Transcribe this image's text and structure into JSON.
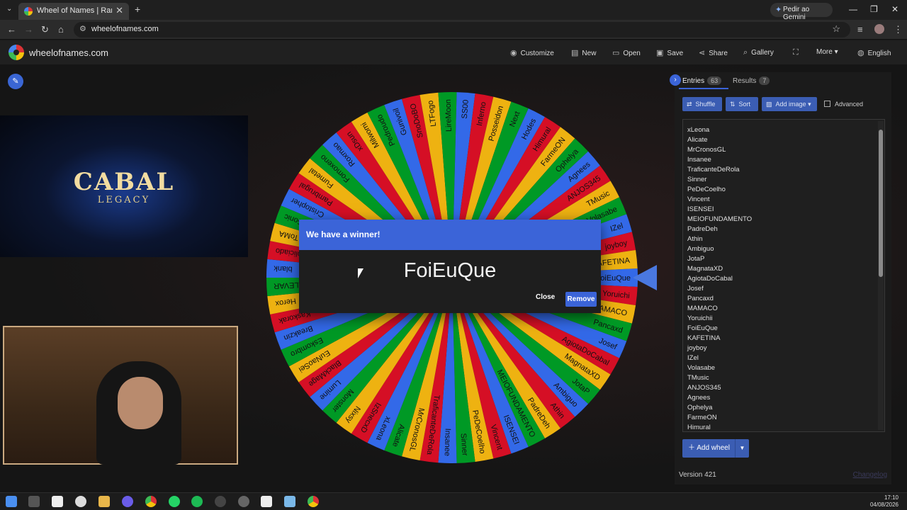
{
  "browser": {
    "tab_title": "Wheel of Names | Random nam",
    "gemini_label": "Pedir ao Gemini",
    "url": "wheelofnames.com",
    "tab_close": "✕",
    "new_tab": "+",
    "win_min": "—",
    "win_max": "❐",
    "win_close": "✕"
  },
  "app": {
    "brand": "wheelofnames.com",
    "menu": [
      {
        "label": "Customize",
        "icon": "palette-icon"
      },
      {
        "label": "New",
        "icon": "file-icon"
      },
      {
        "label": "Open",
        "icon": "folder-icon"
      },
      {
        "label": "Save",
        "icon": "save-icon"
      },
      {
        "label": "Share",
        "icon": "share-icon"
      },
      {
        "label": "Gallery",
        "icon": "search-icon"
      },
      {
        "label": "More",
        "icon": "chevron-down-icon"
      },
      {
        "label": "English",
        "icon": "globe-icon"
      }
    ]
  },
  "stream": {
    "banner_title": "CABAL",
    "banner_subtitle": "LEGACY"
  },
  "wheel": {
    "colors": [
      "#3369e8",
      "#d50f25",
      "#eeb211",
      "#009925"
    ],
    "labels": [
      "FoiEuQue",
      "Yoruichi",
      "MAMACO",
      "Pancaxd",
      "Josef",
      "AgiotaDoCabal",
      "MagnataXD",
      "JotaP",
      "Ambiguo",
      "Athin",
      "PadreDeh",
      "MEIOFUNDAMENTO",
      "ISENSEI",
      "Vincent",
      "PeDeCoelho",
      "Sinner",
      "Insanee",
      "TraficanteDeRola",
      "MrCronosGL",
      "Alicate",
      "xLeona",
      "IzSnecxD",
      "Nixsy",
      "Monster",
      "Lumine",
      "BlackMage",
      "EuNaoSei",
      "Eskombro",
      "Breakzin",
      "Kaskorak",
      "Herox",
      "ALEVAR",
      "blank",
      "Policiado",
      "ToMA",
      "Sonic",
      "Cristopher",
      "Pambrugal",
      "Fumetal",
      "Fomoxeno",
      "Roxmao",
      "xDsun",
      "Milwomi",
      "Pedroudo",
      "Gunivoil",
      "SnoDoBO",
      "LTFogo",
      "LireMoon",
      "SS00",
      "Inferno",
      "Posseidon",
      "Next",
      "Hodes",
      "Himural",
      "FarmeON",
      "Ophelya",
      "Agnees",
      "ANJOS345",
      "TMusic",
      "Volasabe",
      "IZel",
      "joyboy",
      "KAFETINA"
    ]
  },
  "dialog": {
    "title": "We have a winner!",
    "winner": "FoiEuQue",
    "close_label": "Close",
    "remove_label": "Remove"
  },
  "panel": {
    "entries_tab": "Entries",
    "entries_count": "63",
    "results_tab": "Results",
    "results_count": "7",
    "shuffle": "Shuffle",
    "sort": "Sort",
    "add_image": "Add image",
    "advanced": "Advanced",
    "entries": [
      "xLeona",
      "Alicate",
      "MrCronosGL",
      "Insanee",
      "TraficanteDeRola",
      "Sinner",
      "PeDeCoelho",
      "Vincent",
      "ISENSEI",
      "MEIOFUNDAMENTO",
      "PadreDeh",
      "Athin",
      "Ambiguo",
      "JotaP",
      "MagnataXD",
      "AgiotaDoCabal",
      "Josef",
      "Pancaxd",
      "MAMACO",
      "Yoruichii",
      "FoiEuQue",
      "KAFETINA",
      "joyboy",
      "IZel",
      "Volasabe",
      "TMusic",
      "ANJOS345",
      "Agnees",
      "Ophelya",
      "FarmeON",
      "Himural"
    ],
    "add_wheel": "Add wheel",
    "version": "Version 421",
    "changelog": "Changelog"
  },
  "taskbar": {
    "time": "17:10",
    "date": "04/08/2026"
  }
}
